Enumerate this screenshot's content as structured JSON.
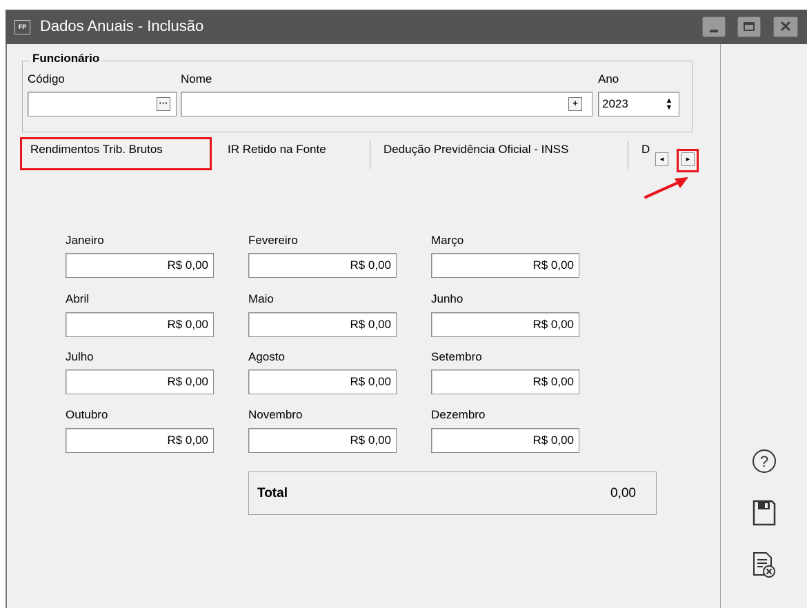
{
  "window": {
    "app_icon_text": "FP",
    "title": "Dados Anuais - Inclusão"
  },
  "funcionario": {
    "group_title": "Funcionário",
    "codigo_label": "Código",
    "codigo_value": "",
    "codigo_button": "···",
    "nome_label": "Nome",
    "nome_value": "",
    "nome_button": "+",
    "ano_label": "Ano",
    "ano_value": "2023"
  },
  "tabs": {
    "items": [
      {
        "label": "Rendimentos Trib. Brutos",
        "selected": true
      },
      {
        "label": "IR Retido na Fonte"
      },
      {
        "label": "Dedução Previdência Oficial - INSS"
      },
      {
        "label": "D"
      }
    ],
    "scroll_left": "◂",
    "scroll_right": "▸"
  },
  "months": [
    {
      "label": "Janeiro",
      "value": "R$ 0,00"
    },
    {
      "label": "Fevereiro",
      "value": "R$ 0,00"
    },
    {
      "label": "Março",
      "value": "R$ 0,00"
    },
    {
      "label": "Abril",
      "value": "R$ 0,00"
    },
    {
      "label": "Maio",
      "value": "R$ 0,00"
    },
    {
      "label": "Junho",
      "value": "R$ 0,00"
    },
    {
      "label": "Julho",
      "value": "R$ 0,00"
    },
    {
      "label": "Agosto",
      "value": "R$ 0,00"
    },
    {
      "label": "Setembro",
      "value": "R$ 0,00"
    },
    {
      "label": "Outubro",
      "value": "R$ 0,00"
    },
    {
      "label": "Novembro",
      "value": "R$ 0,00"
    },
    {
      "label": "Dezembro",
      "value": "R$ 0,00"
    }
  ],
  "total": {
    "label": "Total",
    "value": "0,00"
  },
  "side_icons": [
    "help-icon",
    "save-icon",
    "cancel-document-icon"
  ],
  "colors": {
    "titlebar": "#545454",
    "highlight": "#e8131b",
    "window_bg": "#f0f0f0"
  }
}
